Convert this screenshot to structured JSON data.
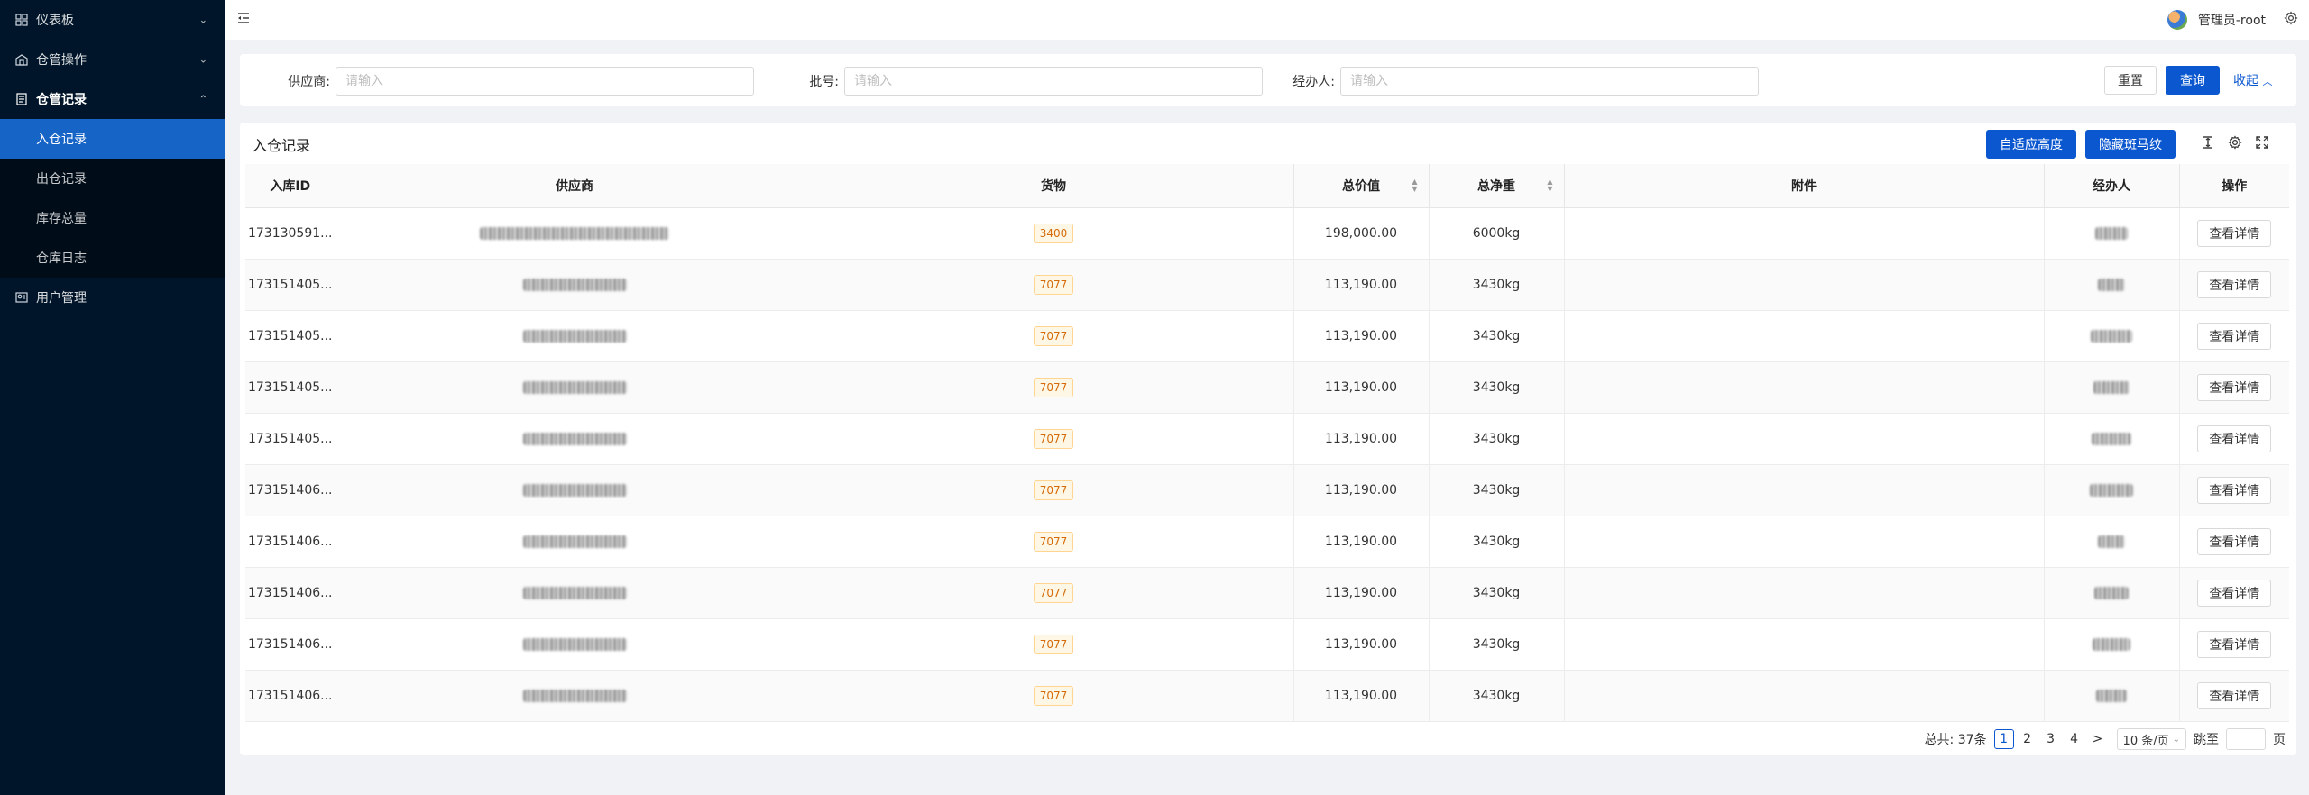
{
  "sidebar": {
    "menus": [
      {
        "label": "仪表板",
        "icon": "dashboard-icon",
        "expanded": false,
        "has_children": true
      },
      {
        "label": "仓管操作",
        "icon": "warehouse-icon",
        "expanded": false,
        "has_children": true
      },
      {
        "label": "仓管记录",
        "icon": "record-icon",
        "expanded": true,
        "has_children": true
      },
      {
        "label": "用户管理",
        "icon": "user-manage-icon",
        "expanded": false,
        "has_children": false
      }
    ],
    "records_sub": [
      "入仓记录",
      "出仓记录",
      "库存总量",
      "仓库日志"
    ],
    "active_sub": "入仓记录"
  },
  "header": {
    "menu_toggle_icon": "menu-fold-icon",
    "user_name": "管理员-root",
    "settings_icon": "gear-icon"
  },
  "search": {
    "fields": [
      {
        "label": "供应商:",
        "placeholder": "请输入",
        "value": ""
      },
      {
        "label": "批号:",
        "placeholder": "请输入",
        "value": ""
      },
      {
        "label": "经办人:",
        "placeholder": "请输入",
        "value": ""
      }
    ],
    "reset_label": "重置",
    "query_label": "查询",
    "collapse_label": "收起"
  },
  "table": {
    "title": "入仓记录",
    "auto_height_label": "自适应高度",
    "hide_stripe_label": "隐藏斑马纹",
    "columns": [
      "入库ID",
      "供应商",
      "货物",
      "总价值",
      "总净重",
      "附件",
      "经办人",
      "操作"
    ],
    "sortable_columns": [
      "总价值",
      "总净重"
    ],
    "action_label": "查看详情",
    "rows": [
      {
        "id": "173130591...",
        "goods": "3400",
        "value": "198,000.00",
        "weight": "6000kg"
      },
      {
        "id": "173151405...",
        "goods": "7077",
        "value": "113,190.00",
        "weight": "3430kg"
      },
      {
        "id": "173151405...",
        "goods": "7077",
        "value": "113,190.00",
        "weight": "3430kg"
      },
      {
        "id": "173151405...",
        "goods": "7077",
        "value": "113,190.00",
        "weight": "3430kg"
      },
      {
        "id": "173151405...",
        "goods": "7077",
        "value": "113,190.00",
        "weight": "3430kg"
      },
      {
        "id": "173151406...",
        "goods": "7077",
        "value": "113,190.00",
        "weight": "3430kg"
      },
      {
        "id": "173151406...",
        "goods": "7077",
        "value": "113,190.00",
        "weight": "3430kg"
      },
      {
        "id": "173151406...",
        "goods": "7077",
        "value": "113,190.00",
        "weight": "3430kg"
      },
      {
        "id": "173151406...",
        "goods": "7077",
        "value": "113,190.00",
        "weight": "3430kg"
      },
      {
        "id": "173151406...",
        "goods": "7077",
        "value": "113,190.00",
        "weight": "3430kg"
      }
    ]
  },
  "pagination": {
    "total_label": "总共: 37条",
    "pages": [
      "1",
      "2",
      "3",
      "4"
    ],
    "current_page": "1",
    "next_label": ">",
    "page_size_label": "10 条/页",
    "jump_label": "跳至",
    "page_suffix": "页"
  },
  "colors": {
    "sidebar_bg": "#001529",
    "active_item": "#1764c7",
    "primary": "#0b57d0",
    "tag_orange": "#d46b08"
  }
}
